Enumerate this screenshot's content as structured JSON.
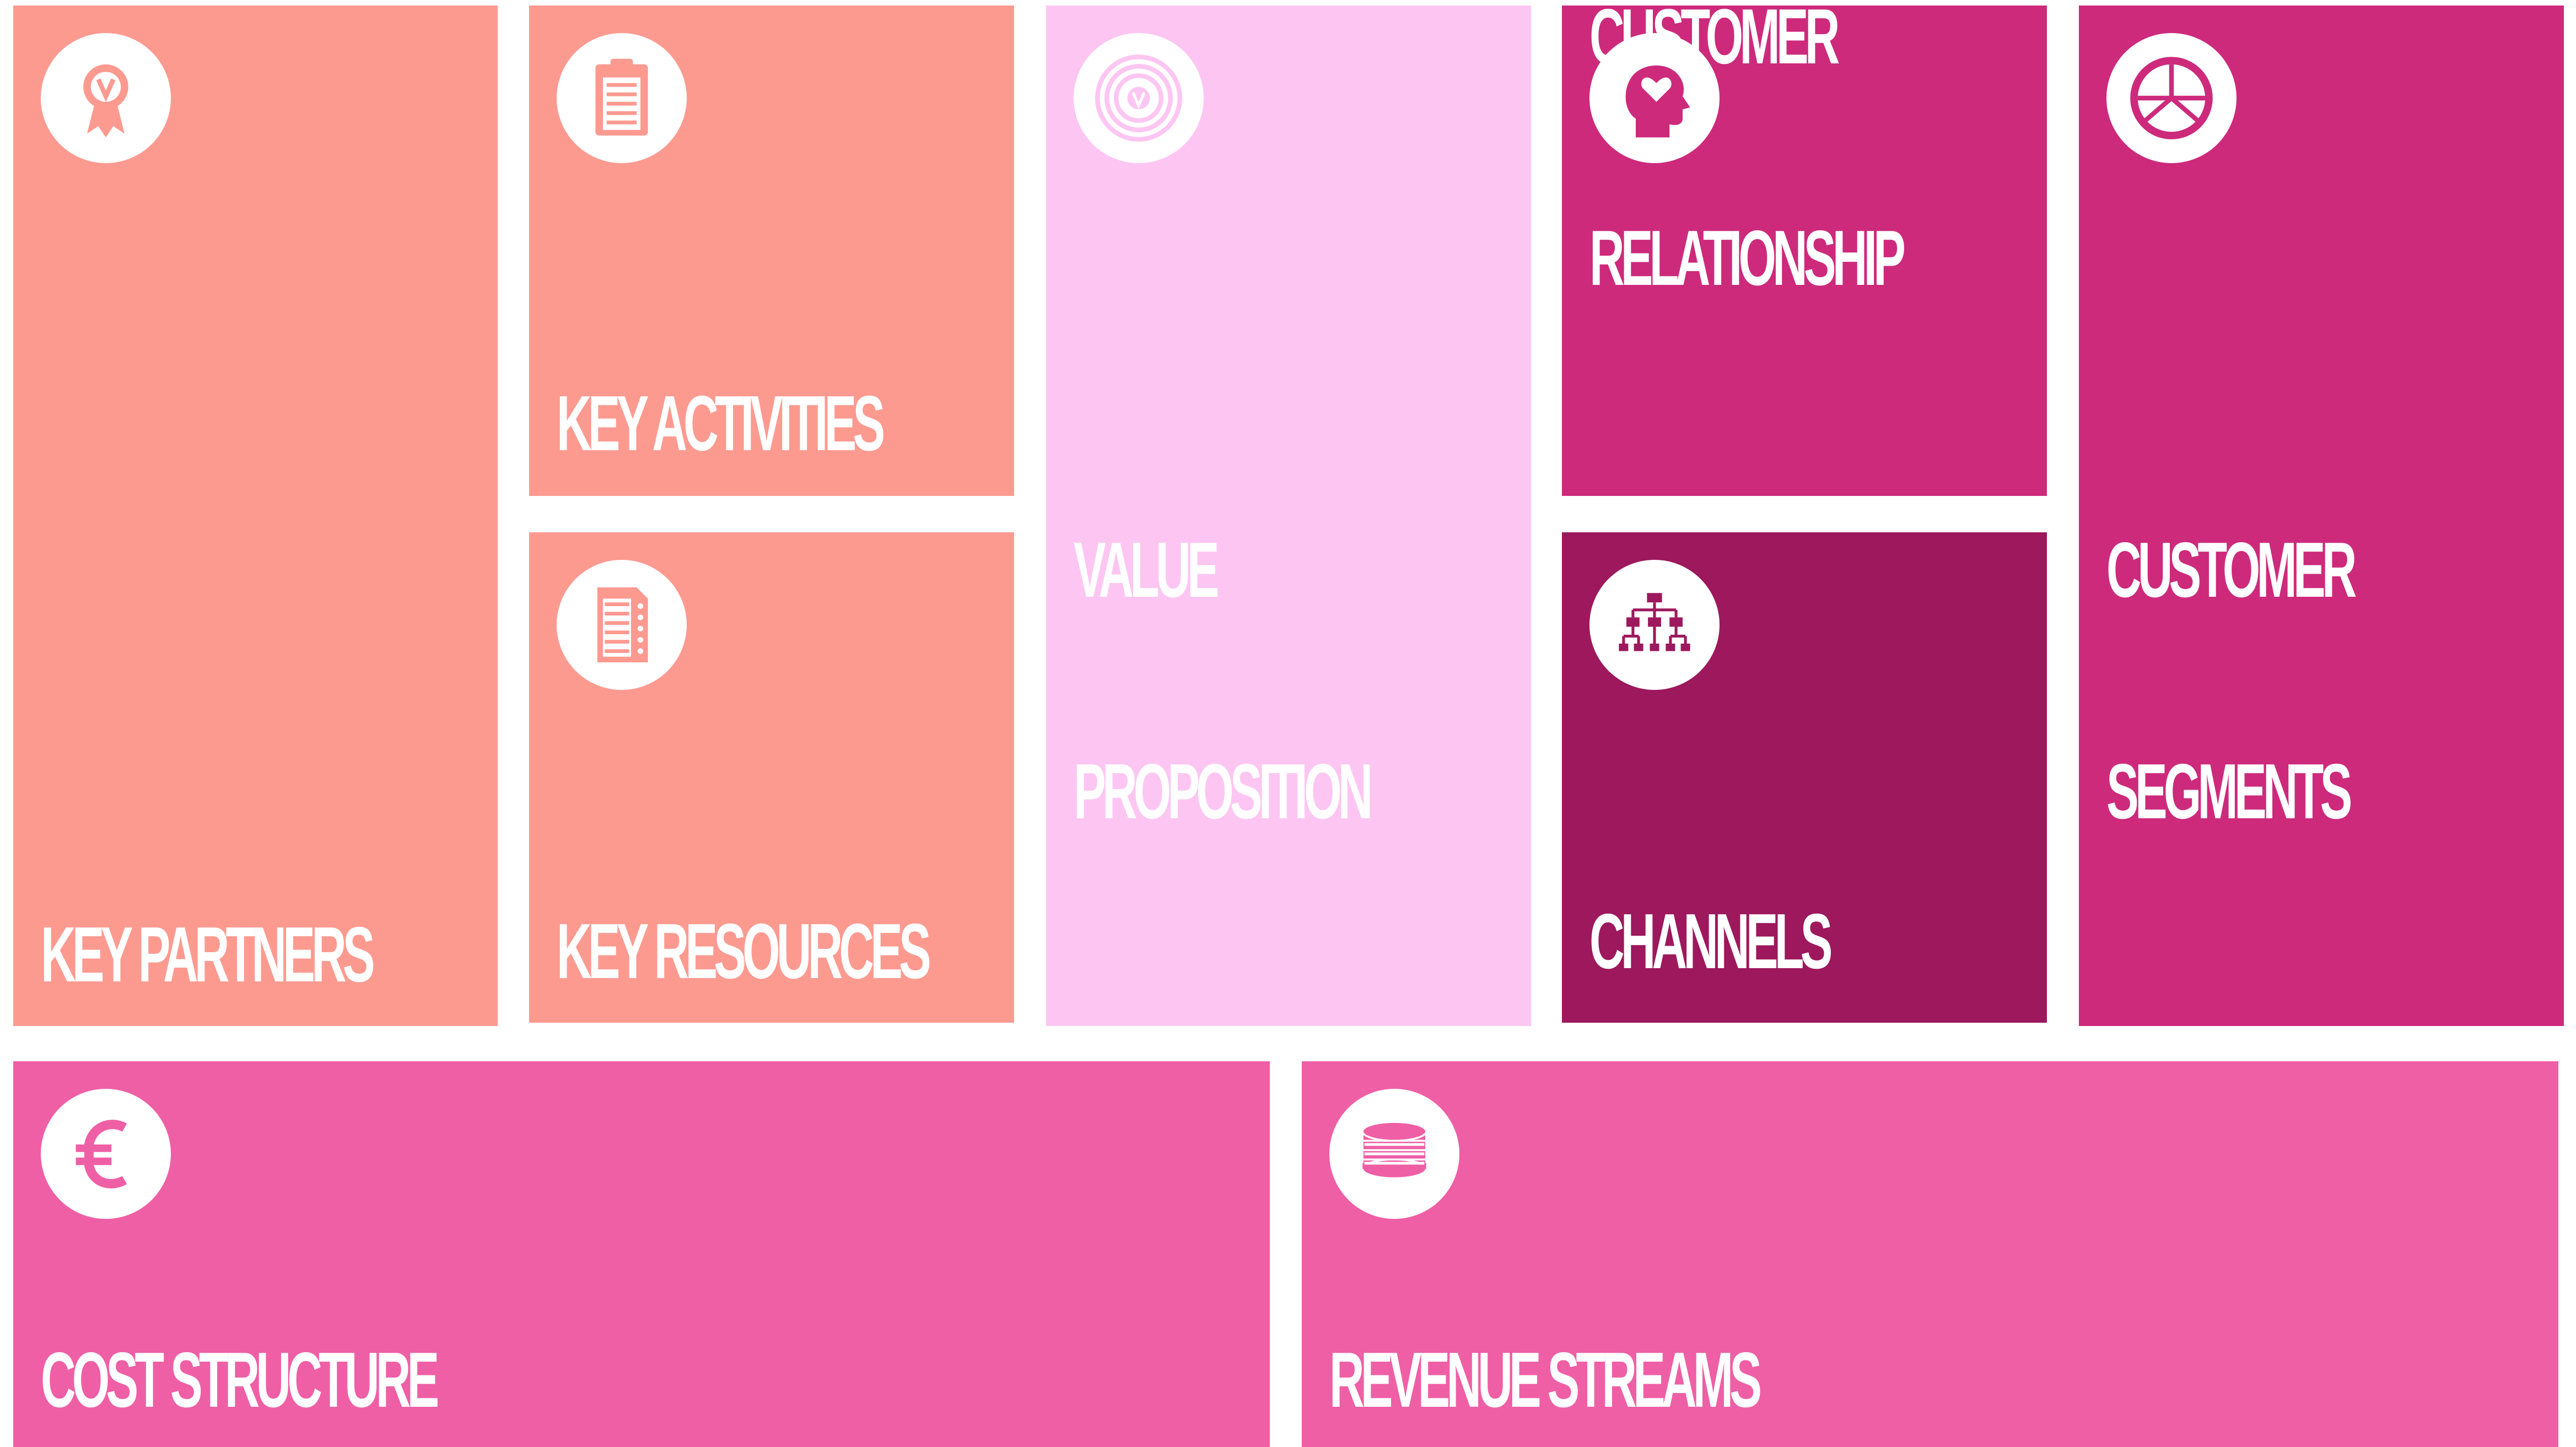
{
  "colors": {
    "salmon": "#fd9a90",
    "light_pink": "#fdc6f2",
    "magenta": "#cd2a7c",
    "dark_magenta": "#9d185c",
    "pink": "#ef5fa5"
  },
  "blocks": {
    "key_partners": {
      "label": "KEY PARTNERS",
      "icon": "award-ribbon-icon"
    },
    "key_activities": {
      "label": "KEY ACTIVITIES",
      "icon": "clipboard-icon"
    },
    "key_resources": {
      "label": "KEY RESOURCES",
      "icon": "document-list-icon"
    },
    "value_proposition": {
      "label_line1": "VALUE",
      "label_line2": "PROPOSITION",
      "icon": "target-icon"
    },
    "customer_relationship": {
      "label_line1": "CUSTOMER",
      "label_line2": "RELATIONSHIP",
      "icon": "head-heart-icon"
    },
    "channels": {
      "label": "CHANNELS",
      "icon": "org-chart-icon"
    },
    "customer_segments": {
      "label_line1": "CUSTOMER",
      "label_line2": "SEGMENTS",
      "icon": "pie-chart-icon"
    },
    "cost_structure": {
      "label": "COST STRUCTURE",
      "icon": "euro-icon"
    },
    "revenue_streams": {
      "label": "REVENUE STREAMS",
      "icon": "coin-stack-icon"
    }
  }
}
